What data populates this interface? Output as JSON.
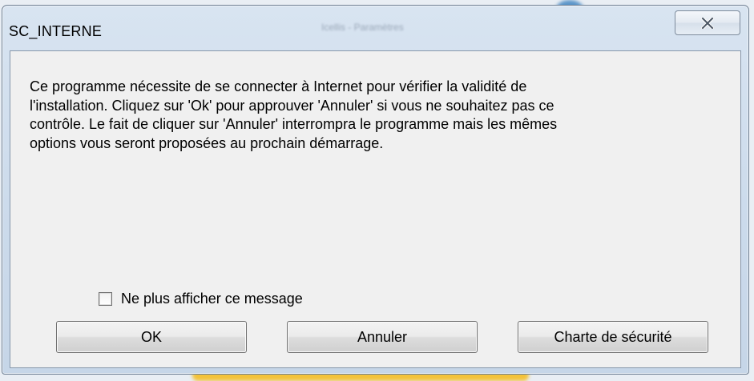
{
  "window": {
    "title": "SC_INTERNE",
    "background_title": "Icellis - Paramètres"
  },
  "titlebar": {
    "close_icon": "close-icon"
  },
  "dialog": {
    "message": "Ce programme nécessite de se connecter à Internet pour vérifier la validité de\nl'installation. Cliquez sur 'Ok' pour approuver 'Annuler' si vous ne souhaitez pas ce\ncontrôle. Le fait de cliquer sur 'Annuler' interrompra le programme mais les mêmes\noptions vous seront proposées au prochain démarrage.",
    "checkbox_label": "Ne plus afficher ce message",
    "checkbox_checked": false
  },
  "buttons": {
    "ok_label": "OK",
    "cancel_label": "Annuler",
    "charter_label": "Charte de sécurité"
  },
  "colors": {
    "frame": "#cbdaeb",
    "client": "#f0f0f0",
    "button": "#e5e5e5"
  }
}
